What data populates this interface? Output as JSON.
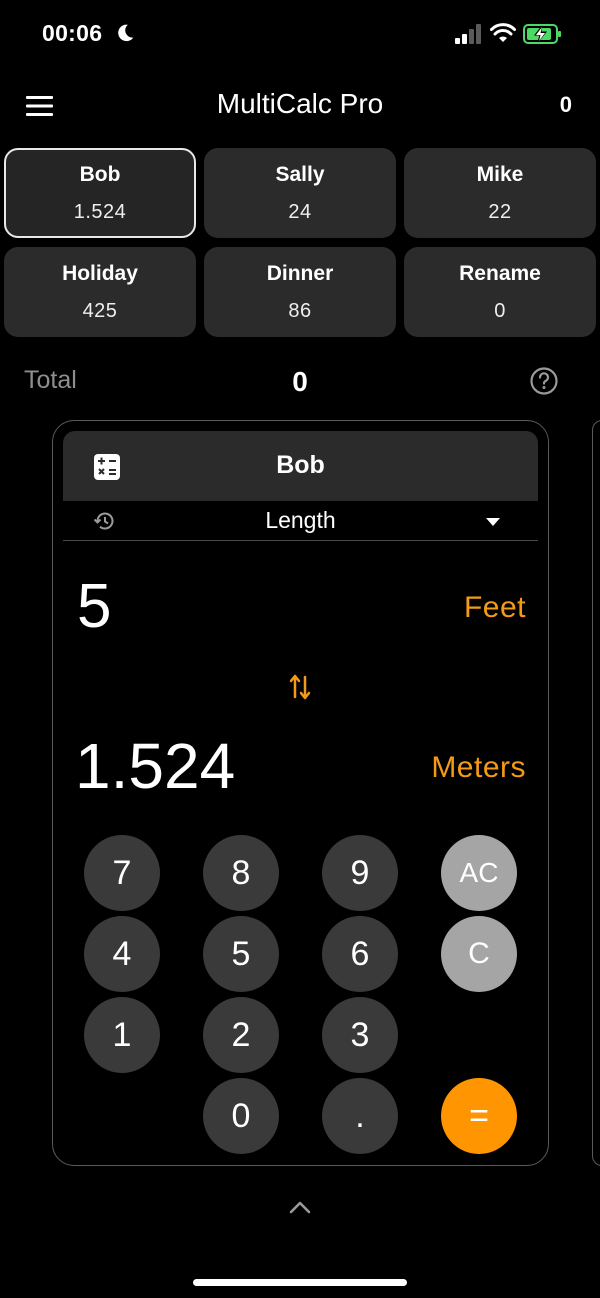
{
  "status": {
    "time": "00:06",
    "icons": [
      "moon-icon",
      "signal-icon",
      "wifi-icon",
      "battery-charging-icon"
    ],
    "battery_color": "#4cd964"
  },
  "header": {
    "title": "MultiCalc Pro",
    "count": "0",
    "menu_icon": "hamburger-menu-icon"
  },
  "tiles": [
    {
      "name": "Bob",
      "value": "1.524",
      "selected": true
    },
    {
      "name": "Sally",
      "value": "24",
      "selected": false
    },
    {
      "name": "Mike",
      "value": "22",
      "selected": false
    },
    {
      "name": "Holiday",
      "value": "425",
      "selected": false
    },
    {
      "name": "Dinner",
      "value": "86",
      "selected": false
    },
    {
      "name": "Rename",
      "value": "0",
      "selected": false
    }
  ],
  "total": {
    "label": "Total",
    "value": "0",
    "help_icon": "question-circle-icon"
  },
  "calculator": {
    "title": "Bob",
    "title_icon": "calculator-icon",
    "mode": "Length",
    "history_icon": "history-icon",
    "input_value": "5",
    "input_unit": "Feet",
    "output_value": "1.524",
    "output_unit": "Meters",
    "accent_color": "#ff9500",
    "keys": {
      "k7": "7",
      "k8": "8",
      "k9": "9",
      "ac": "AC",
      "k4": "4",
      "k5": "5",
      "k6": "6",
      "c": "C",
      "k1": "1",
      "k2": "2",
      "k3": "3",
      "k0": "0",
      "dot": ".",
      "equals": "="
    }
  }
}
